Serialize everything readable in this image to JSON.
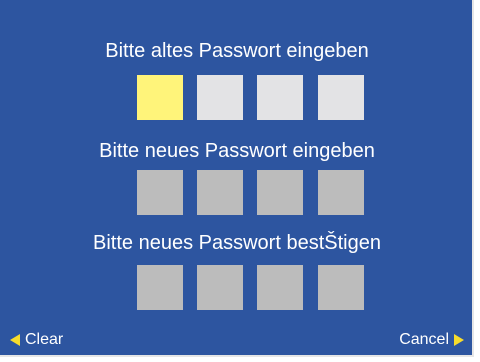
{
  "prompts": {
    "old": "Bitte altes Passwort eingeben",
    "new": "Bitte neues Passwort eingeben",
    "confirm": "Bitte neues Passwort bestŠtigen"
  },
  "fields": {
    "old": [
      "active",
      "idle",
      "idle",
      "idle"
    ],
    "new": [
      "disabled",
      "disabled",
      "disabled",
      "disabled"
    ],
    "confirm": [
      "disabled",
      "disabled",
      "disabled",
      "disabled"
    ]
  },
  "footer": {
    "clear_label": "Clear",
    "cancel_label": "Cancel"
  },
  "colors": {
    "background": "#2d55a0",
    "active_box": "#fff47a",
    "idle_box": "#e3e3e5",
    "disabled_box": "#bcbcbc",
    "arrow": "#f7dc2c",
    "text": "#ffffff"
  },
  "icons": {
    "clear": "arrow-left-icon",
    "cancel": "arrow-right-icon"
  }
}
